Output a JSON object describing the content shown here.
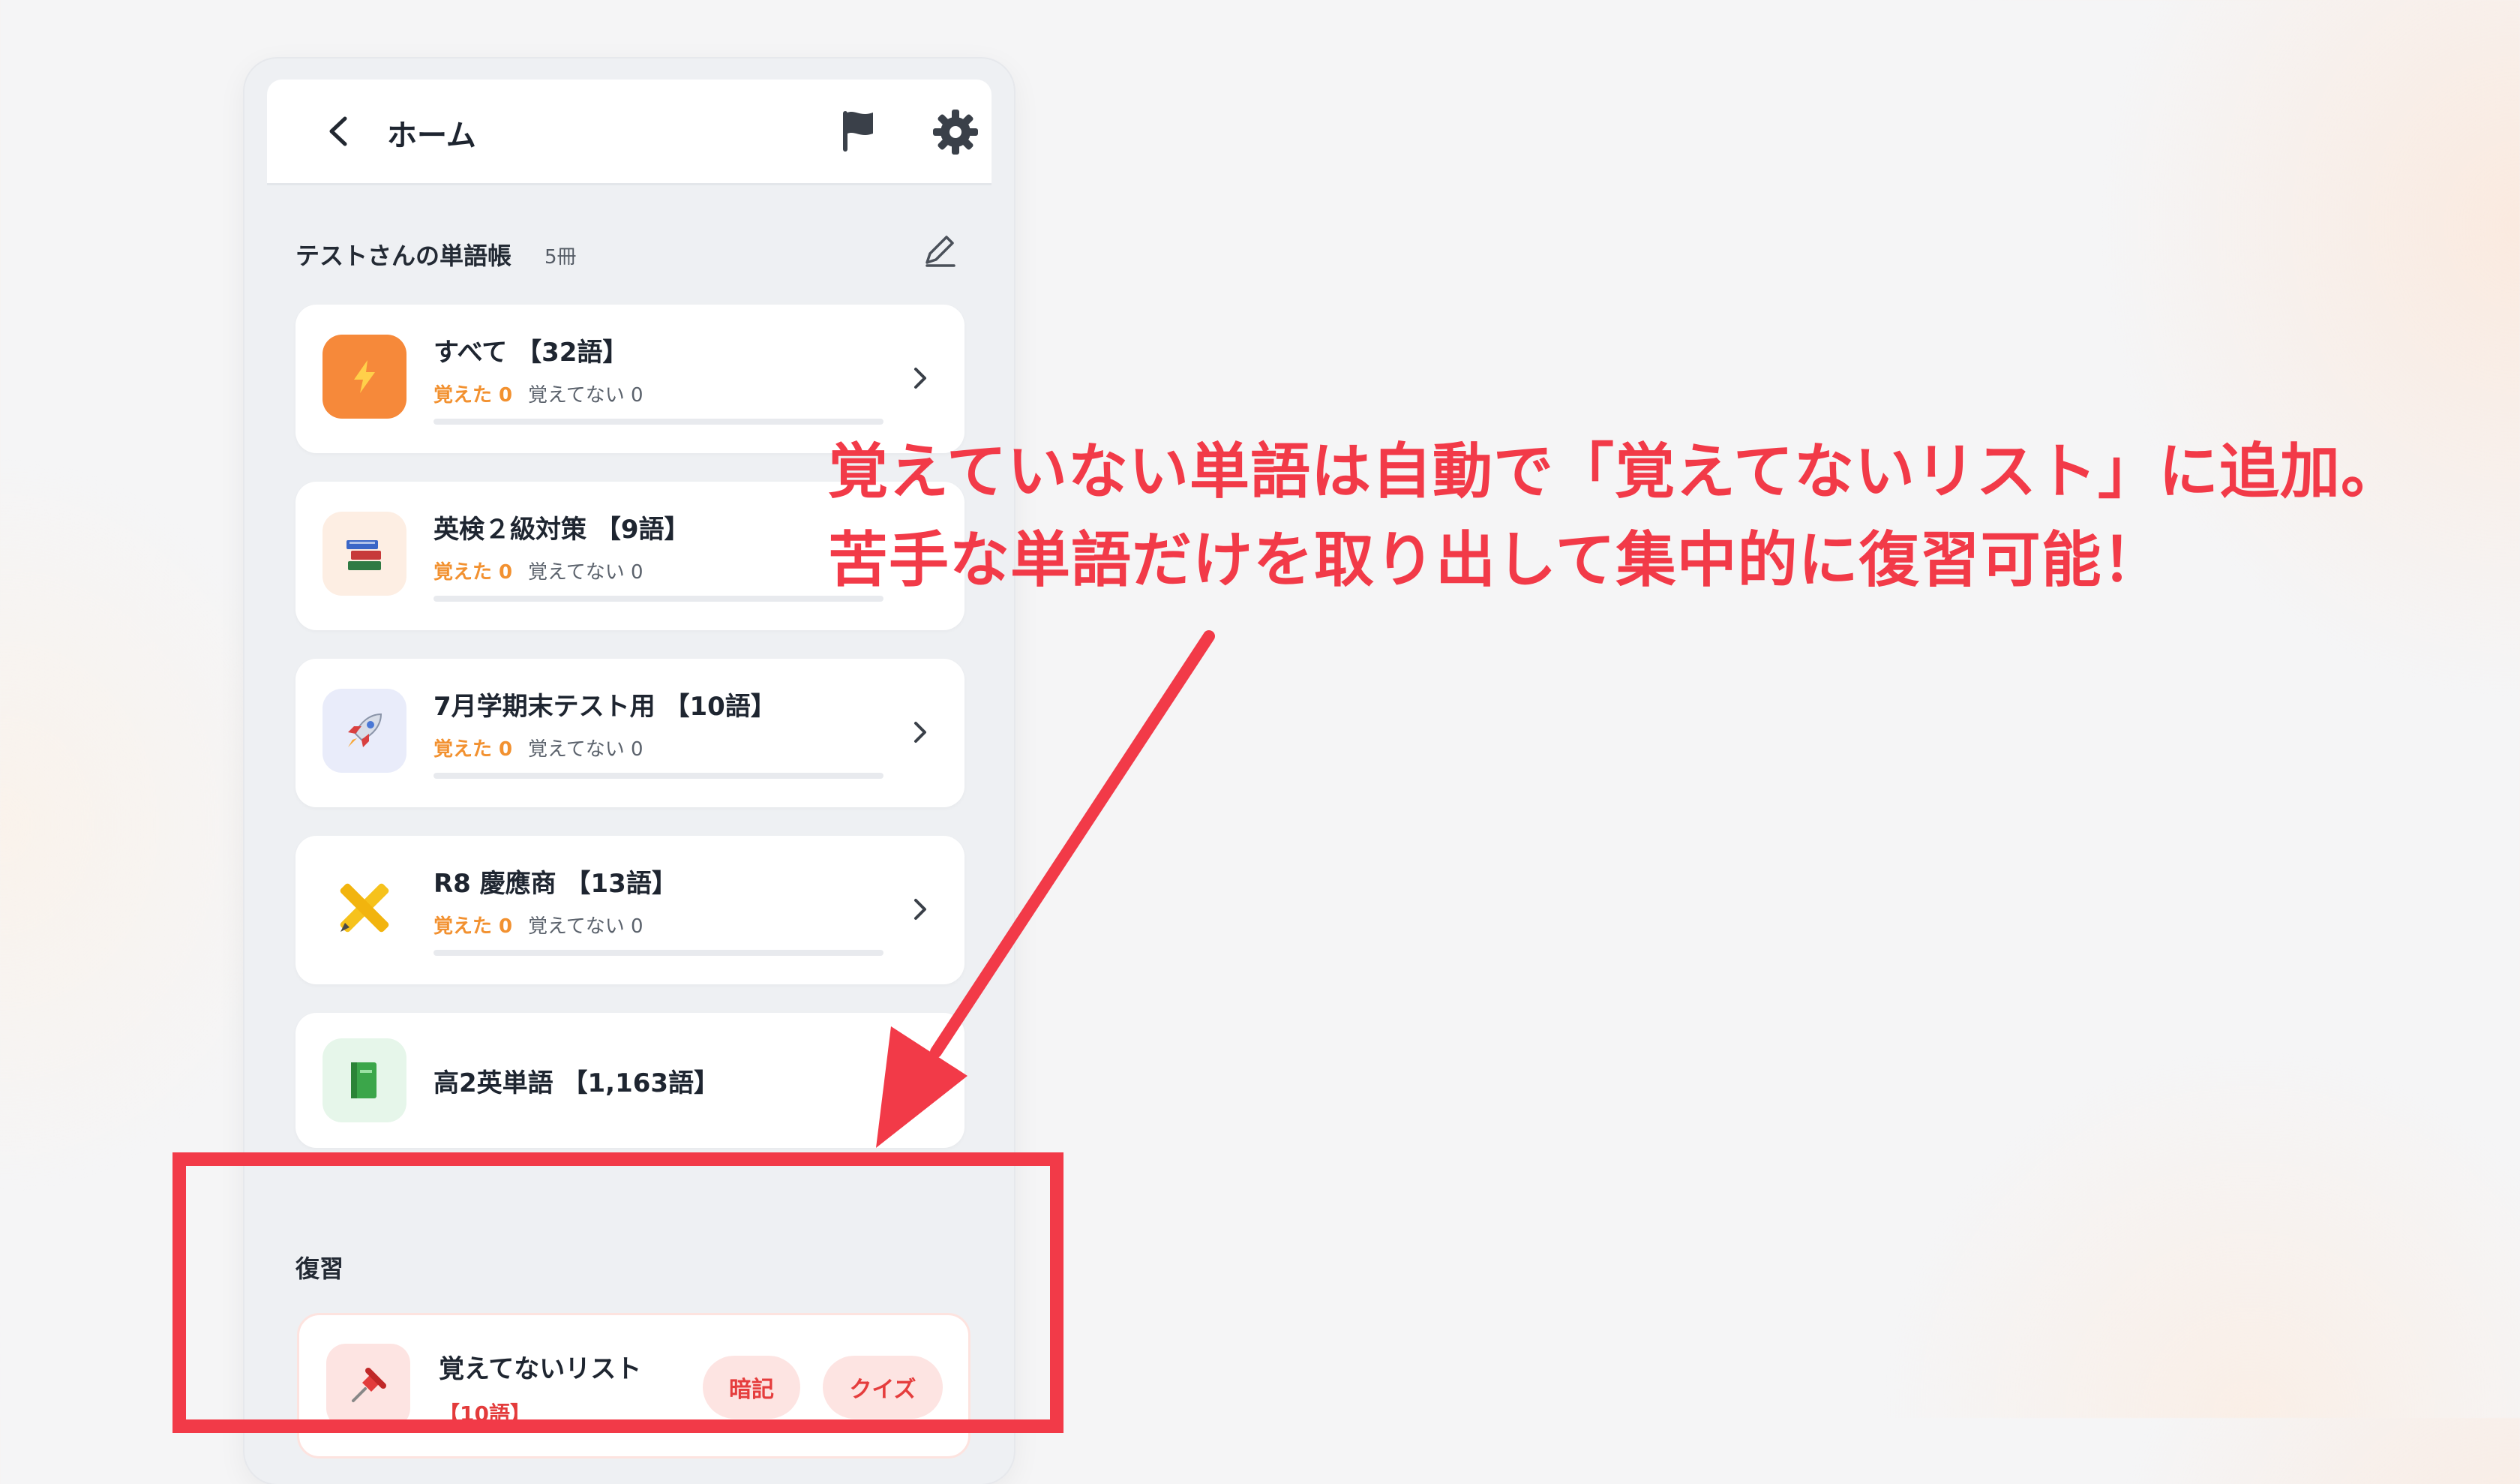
{
  "header": {
    "title": "ホーム"
  },
  "wordbooks": {
    "section_title": "テストさんの単語帳",
    "count": "5冊",
    "items": [
      {
        "title": "すべて 【32語】",
        "known": "覚えた 0",
        "unknown": "覚えてない 0",
        "progress": 0,
        "icon": "lightning-icon"
      },
      {
        "title": "英検２級対策 【9語】",
        "known": "覚えた 0",
        "unknown": "覚えてない 0",
        "progress": 0,
        "icon": "books-icon"
      },
      {
        "title": "7月学期末テスト用 【10語】",
        "known": "覚えた 0",
        "unknown": "覚えてない 0",
        "progress": 0,
        "icon": "rocket-icon"
      },
      {
        "title": "R8 慶應商 【13語】",
        "known": "覚えた 0",
        "unknown": "覚えてない 0",
        "progress": 0,
        "icon": "pencil-ruler-icon"
      },
      {
        "title": "高2英単語 【1,163語】",
        "icon": "green-book-icon"
      }
    ]
  },
  "review": {
    "section_title": "復習",
    "list_name": "覚えてないリスト",
    "list_count": "【10語】",
    "memorize_label": "暗記",
    "quiz_label": "クイズ"
  },
  "annotation": {
    "line1": "覚えていない単語は自動で「覚えてないリスト」に追加。",
    "line2": "苦手な単語だけを取り出して集中的に復習可能！"
  },
  "colors": {
    "accent_orange": "#f29130",
    "annotation_red": "#f23a48",
    "pill_bg": "#fde4e2"
  }
}
